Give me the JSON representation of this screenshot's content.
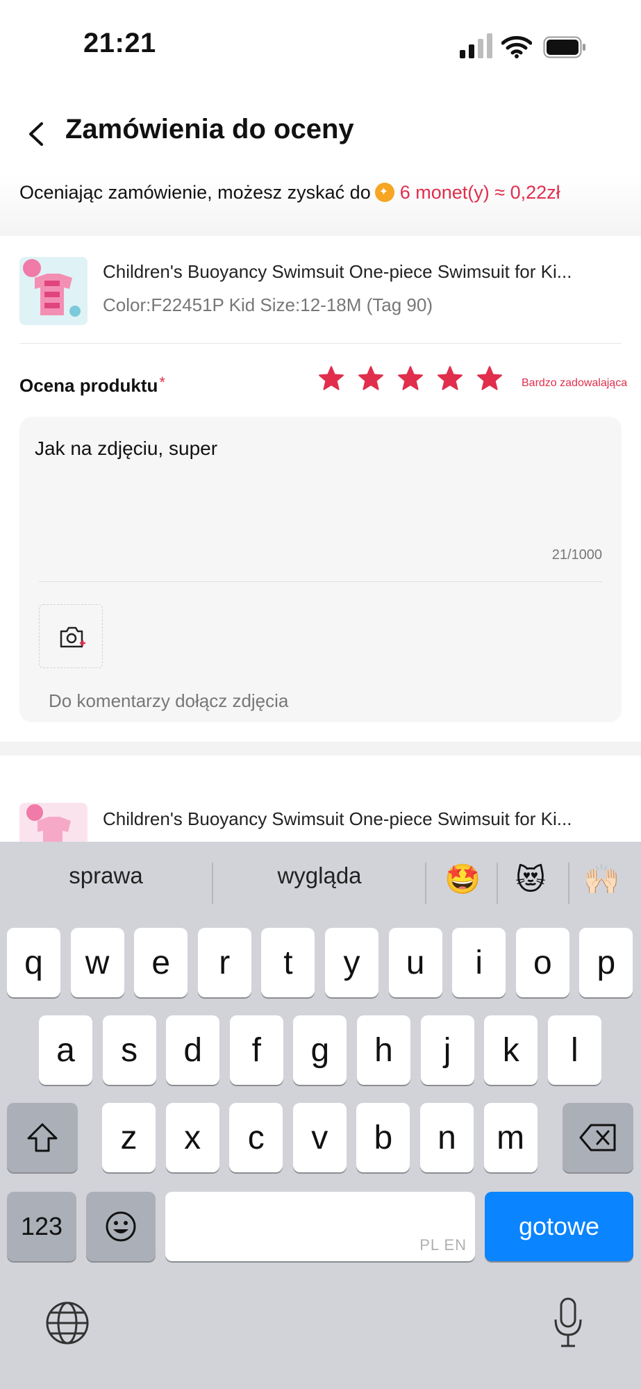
{
  "status_bar": {
    "time": "21:21"
  },
  "header": {
    "title": "Zamówienia do oceny"
  },
  "banner": {
    "text": "Oceniając zamówienie, możesz zyskać do",
    "reward": "6 monet(y) ≈ 0,22zł"
  },
  "product1": {
    "name": "Children's Buoyancy Swimsuit One-piece Swimsuit for Ki...",
    "variant": "Color:F22451P Kid Size:12-18M (Tag 90)",
    "rating_label": "Ocena produktu",
    "required_mark": "*",
    "rating_value": 5,
    "rating_max": 5,
    "rating_text": "Bardzo zadowalająca",
    "review_text": "Jak na zdjęciu, super",
    "char_count": "21/1000",
    "photo_hint": "Do komentarzy dołącz zdjęcia"
  },
  "product2": {
    "name": "Children's Buoyancy Swimsuit One-piece Swimsuit for Ki..."
  },
  "keyboard": {
    "suggestions": [
      "sprawa",
      "wygląda"
    ],
    "emoji_suggestions": [
      "🤩",
      "😻",
      "🙌🏻"
    ],
    "row1": [
      "q",
      "w",
      "e",
      "r",
      "t",
      "y",
      "u",
      "i",
      "o",
      "p"
    ],
    "row2": [
      "a",
      "s",
      "d",
      "f",
      "g",
      "h",
      "j",
      "k",
      "l"
    ],
    "row3": [
      "z",
      "x",
      "c",
      "v",
      "b",
      "n",
      "m"
    ],
    "numbers_key": "123",
    "space_languages": "PL EN",
    "return_key": "gotowe"
  },
  "colors": {
    "accent": "#e02e4c",
    "coin": "#f6a623",
    "keyboard_bg": "#d1d3d9",
    "return_key": "#0a84ff"
  },
  "icons": [
    "back-arrow-icon",
    "coin-icon",
    "star-icon",
    "camera-add-icon",
    "shift-icon",
    "backspace-icon",
    "emoji-icon",
    "globe-icon",
    "microphone-icon",
    "signal-icon",
    "wifi-icon",
    "battery-icon"
  ]
}
